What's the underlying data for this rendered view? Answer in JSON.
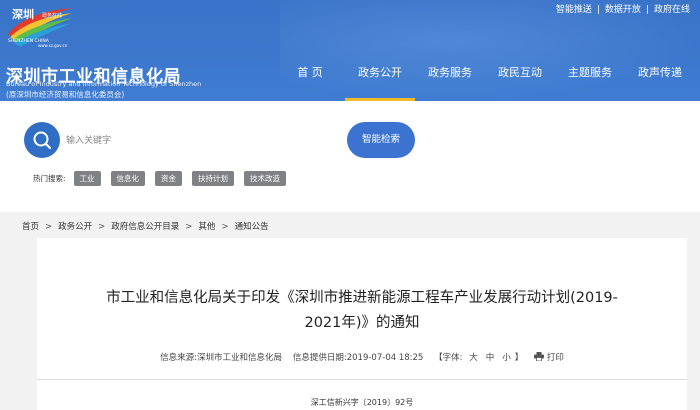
{
  "header": {
    "top_links": [
      "智能推送",
      "数据开放",
      "政府在线"
    ],
    "logo_text": "深圳 政务在线 SHENZHEN CHINA www.sz.gov.cn",
    "title": "深圳市工业和信息化局",
    "subtitle_en": "Bureau of Industry and Information Technology of Shenzhen",
    "subtitle_cn": "(原深圳市经济贸易和信息化委员会)"
  },
  "nav": {
    "items": [
      {
        "label": "首 页"
      },
      {
        "label": "政务公开"
      },
      {
        "label": "政务服务"
      },
      {
        "label": "政民互动"
      },
      {
        "label": "主题服务"
      },
      {
        "label": "政声传递"
      }
    ],
    "active_index": 1
  },
  "search": {
    "placeholder": "输入关键字",
    "button_label": "智能检索",
    "hot_label": "热门搜索:",
    "hot_tags": [
      "工业",
      "信息化",
      "资金",
      "扶持计划",
      "技术改造"
    ]
  },
  "breadcrumb": [
    "首页",
    "政务公开",
    "政府信息公开目录",
    "其他",
    "通知公告"
  ],
  "article": {
    "title_line1": "市工业和信息化局关于印发《深圳市推进新能源工程车产业发展行动计划(2019-",
    "title_line2": "2021年)》的通知",
    "source_label": "信息来源:",
    "source": "深圳市工业和信息化局",
    "date_label": "信息提供日期:",
    "date": "2019-07-04 18:25",
    "font_label": "【字体:",
    "font_large": "大",
    "font_medium": "中",
    "font_small": "小",
    "font_close": "】",
    "print_label": "打印",
    "doc_number": "深工信新兴字〔2019〕92号"
  },
  "colors": {
    "header_blue": "#3c77cc",
    "accent_yellow": "#f1b92b",
    "button_blue": "#3c73d0",
    "tag_gray": "#7f8184"
  }
}
